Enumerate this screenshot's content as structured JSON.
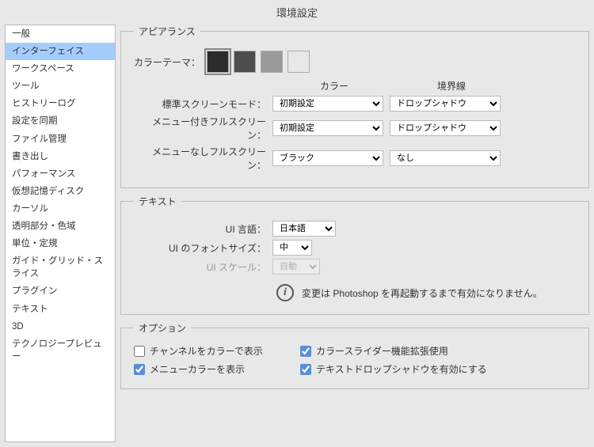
{
  "window_title": "環境設定",
  "sidebar": {
    "items": [
      "一般",
      "インターフェイス",
      "ワークスペース",
      "ツール",
      "ヒストリーログ",
      "設定を同期",
      "ファイル管理",
      "書き出し",
      "パフォーマンス",
      "仮想記憶ディスク",
      "カーソル",
      "透明部分・色域",
      "単位・定規",
      "ガイド・グリッド・スライス",
      "プラグイン",
      "テキスト",
      "3D",
      "テクノロジープレビュー"
    ],
    "selected_index": 1
  },
  "appearance": {
    "legend": "アピアランス",
    "color_theme_label": "カラーテーマ：",
    "swatches": [
      "#2b2b2b",
      "#4d4d4d",
      "#9a9a9a",
      "#e8e8e8"
    ],
    "selected_swatch": 0,
    "col_header_color": "カラー",
    "col_header_border": "境界線",
    "rows": [
      {
        "label": "標準スクリーンモード：",
        "color": "初期設定",
        "border": "ドロップシャドウ"
      },
      {
        "label": "メニュー付きフルスクリーン：",
        "color": "初期設定",
        "border": "ドロップシャドウ"
      },
      {
        "label": "メニューなしフルスクリーン：",
        "color": "ブラック",
        "border": "なし"
      }
    ]
  },
  "text": {
    "legend": "テキスト",
    "lang_label": "UI 言語：",
    "lang_value": "日本語",
    "font_size_label": "UI のフォントサイズ：",
    "font_size_value": "中",
    "scale_label": "UI スケール：",
    "scale_value": "自動",
    "info": "変更は Photoshop を再起動するまで有効になりません。"
  },
  "options": {
    "legend": "オプション",
    "items": [
      {
        "label": "チャンネルをカラーで表示",
        "checked": false
      },
      {
        "label": "カラースライダー機能拡張使用",
        "checked": true
      },
      {
        "label": "メニューカラーを表示",
        "checked": true
      },
      {
        "label": "テキストドロップシャドウを有効にする",
        "checked": true
      }
    ]
  }
}
